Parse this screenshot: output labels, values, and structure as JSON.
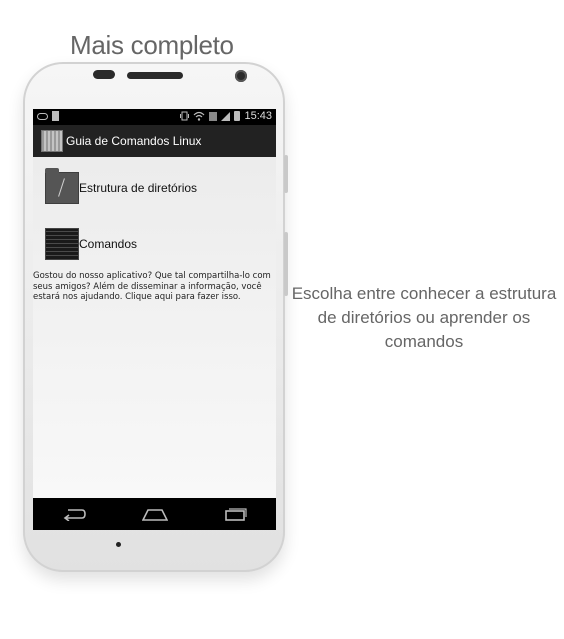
{
  "promo": {
    "headline": "Mais completo",
    "caption": "Escolha entre conhecer a estrutura de diretórios ou aprender os comandos"
  },
  "statusbar": {
    "time": "15:43",
    "icons": [
      "voicemail-icon",
      "sd-card-icon",
      "vibrate-icon",
      "wifi-icon",
      "data-icon",
      "signal-icon",
      "battery-icon"
    ]
  },
  "app": {
    "title": "Guia de Comandos Linux",
    "menu": [
      {
        "label": "Estrutura de diretórios",
        "icon": "folder-icon"
      },
      {
        "label": "Comandos",
        "icon": "terminal-icon"
      }
    ],
    "share_text": "Gostou do nosso aplicativo? Que tal compartilha-lo com seus amigos? Além de disseminar a informação, você estará nos ajudando. Clique aqui para fazer isso."
  },
  "navbar": {
    "buttons": [
      "back-icon",
      "home-icon",
      "recent-apps-icon"
    ]
  },
  "colors": {
    "actionbar": "#222222",
    "content_bg": "#ececec",
    "caption_text": "#666666"
  }
}
